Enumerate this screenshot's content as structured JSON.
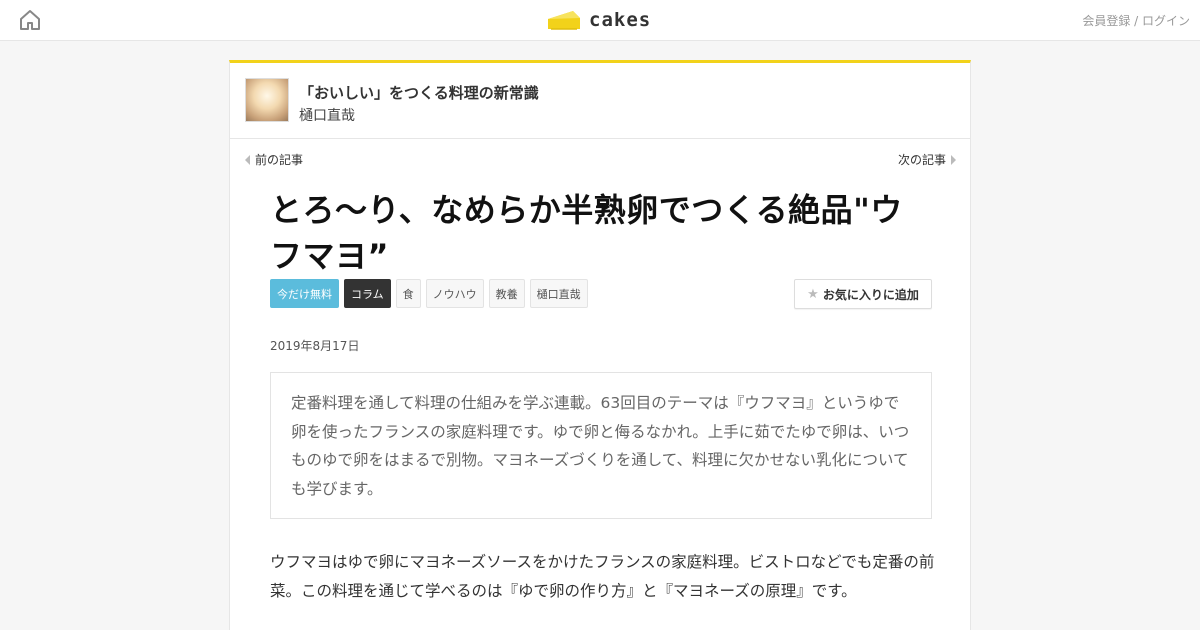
{
  "header": {
    "logo_text": "cakes",
    "auth_link": "会員登録 / ログイン"
  },
  "series": {
    "title": "「おいしい」をつくる料理の新常識",
    "author": "樋口直哉"
  },
  "pager": {
    "prev_label": "前の記事",
    "next_label": "次の記事"
  },
  "article": {
    "title": "とろ〜り、なめらか半熟卵でつくる絶品\"ウフマヨ”",
    "tags": {
      "free": "今だけ無料",
      "column": "コラム",
      "food": "食",
      "knowhow": "ノウハウ",
      "culture": "教養",
      "author": "樋口直哉"
    },
    "favorite_label": "お気に入りに追加",
    "date": "2019年8月17日",
    "lead": "定番料理を通して料理の仕組みを学ぶ連載。63回目のテーマは『ウフマヨ』というゆで卵を使ったフランスの家庭料理です。ゆで卵と侮るなかれ。上手に茹でたゆで卵は、いつものゆで卵をはまるで別物。マヨネーズづくりを通して、料理に欠かせない乳化についても学びます。",
    "body": "ウフマヨはゆで卵にマヨネーズソースをかけたフランスの家庭料理。ビストロなどでも定番の前菜。この料理を通じて学べるのは『ゆで卵の作り方』と『マヨネーズの原理』です。"
  },
  "icons": {
    "home": "home-icon",
    "logo": "cheesecake-logo-icon",
    "prev": "triangle-left-icon",
    "next": "triangle-right-icon",
    "favorite": "star-icon"
  },
  "colors": {
    "accent_yellow": "#f2d21a",
    "free_tag": "#5bbcdc",
    "column_tag": "#333333"
  }
}
